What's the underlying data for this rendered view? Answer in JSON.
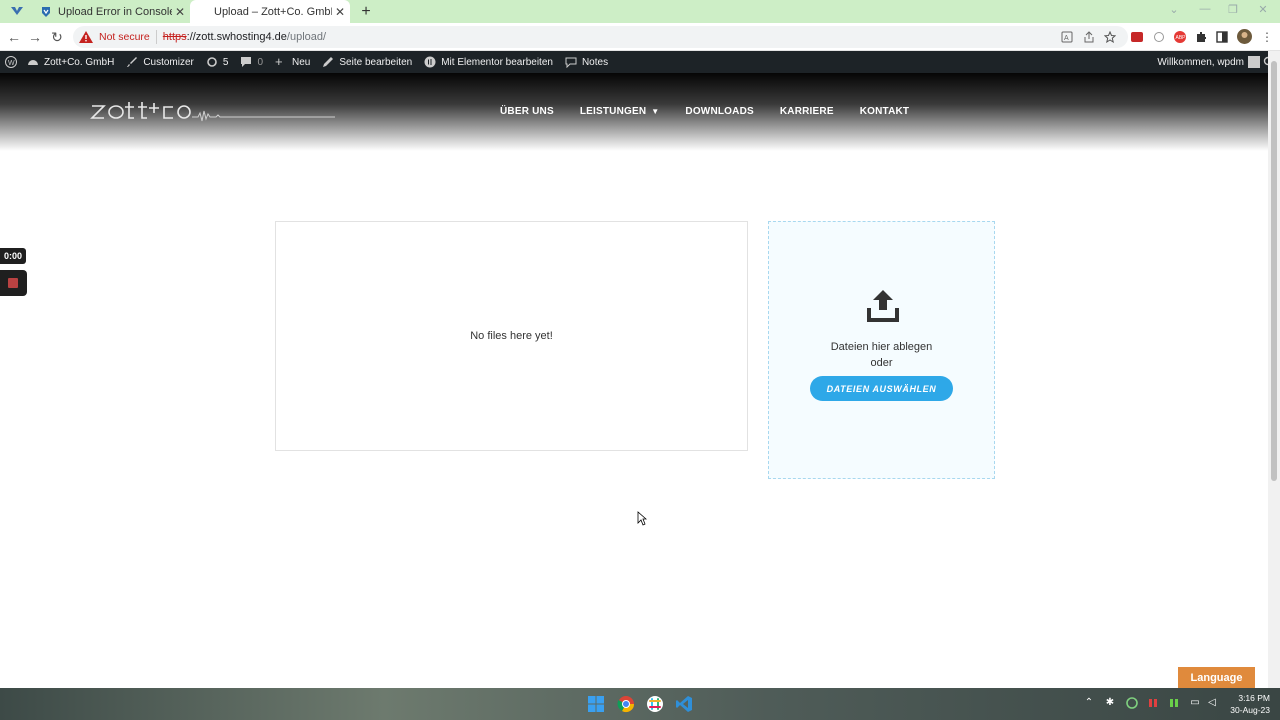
{
  "browser": {
    "tabs": [
      {
        "title": "Upload Error in Console - WordP",
        "active": false
      },
      {
        "title": "Upload – Zott+Co. GmbH",
        "active": true
      }
    ],
    "security_label": "Not secure",
    "url_proto": "https",
    "url_host": "://zott.swhosting4.de",
    "url_path": "/upload/"
  },
  "adminbar": {
    "site_name": "Zott+Co. GmbH",
    "customizer": "Customizer",
    "updates_count": "5",
    "comments_count": "0",
    "new_label": "Neu",
    "edit_page": "Seite bearbeiten",
    "elementor_edit": "Mit Elementor bearbeiten",
    "notes": "Notes",
    "welcome": "Willkommen, wpdm"
  },
  "site": {
    "nav": {
      "ueber_uns": "ÜBER UNS",
      "leistungen": "LEISTUNGEN",
      "downloads": "DOWNLOADS",
      "karriere": "KARRIERE",
      "kontakt": "KONTAKT"
    }
  },
  "recorder": {
    "time": "0:00"
  },
  "content": {
    "empty_message": "No files here yet!",
    "drop_line1": "Dateien hier ablegen",
    "drop_line2": "oder",
    "select_button": "DATEIEN AUSWÄHLEN"
  },
  "language_button": "Language",
  "taskbar": {
    "time": "3:16 PM",
    "date": "30-Aug-23"
  },
  "colors": {
    "accent": "#2ea8e8",
    "tabstrip": "#cdeec6",
    "adminbar": "#1d2327",
    "language": "#e08a3c",
    "not_secure": "#c5221f"
  }
}
